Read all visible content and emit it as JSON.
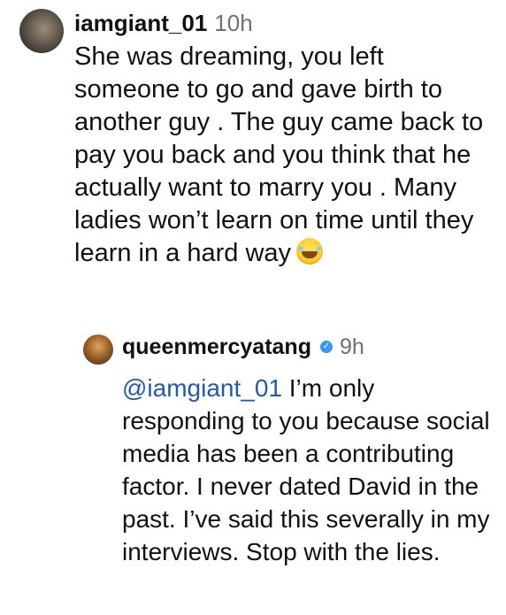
{
  "comments": [
    {
      "username": "iamgiant_01",
      "time": "10h",
      "text": "She was dreaming, you left someone to go and gave birth to another guy . The guy came back to pay you back and you think that he actually want to marry you . Many ladies won’t learn on time until they learn in a hard way",
      "emoji": "face-with-tears-of-joy"
    },
    {
      "username": "queenmercyatang",
      "verified": true,
      "time": "9h",
      "mention": "@iamgiant_01",
      "text": "I’m only responding to you because social media has been a contributing factor. I never dated David in the past. I’ve said this severally in my interviews. Stop with the lies."
    }
  ],
  "colors": {
    "text": "#111111",
    "timestamp": "#707070",
    "mention": "#2a5a9a",
    "verified_badge": "#3897f0",
    "background": "#ffffff"
  }
}
